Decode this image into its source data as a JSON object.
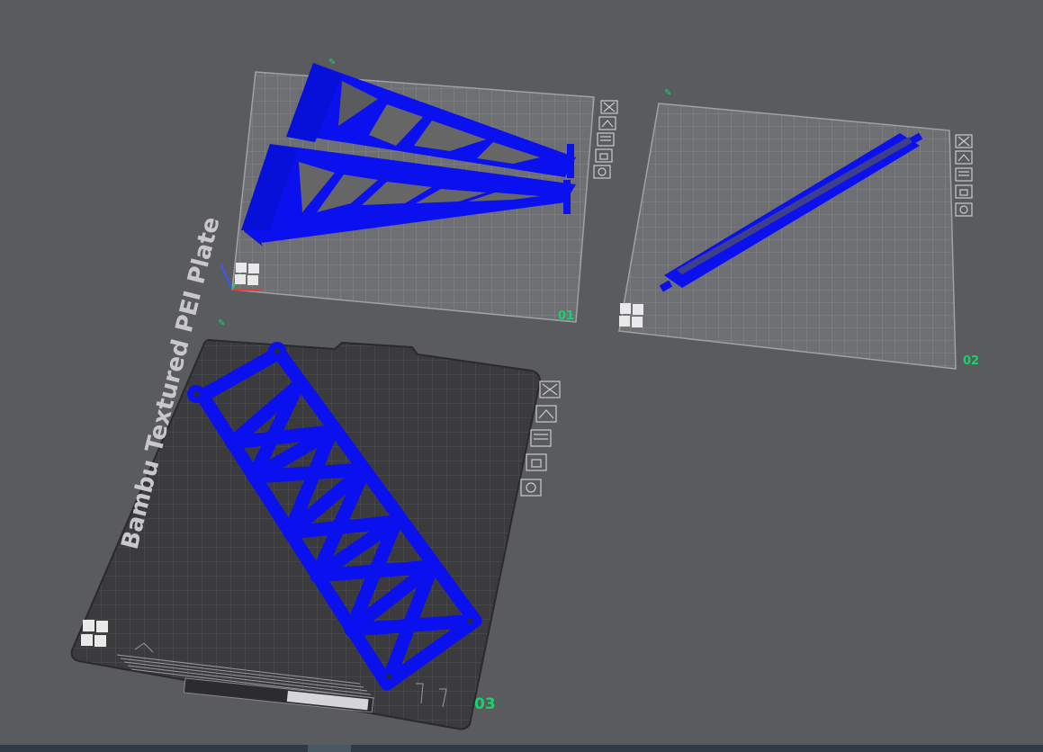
{
  "colors": {
    "background": "#5a5b5f",
    "plate_light": "#6b6c70",
    "plate_grid": "#8b8c90",
    "plate_dark": "#3a3a3d",
    "part": "#0a10ee",
    "plate_number": "#1bd26a"
  },
  "plates": [
    {
      "number": "01",
      "tool_icons": [
        "close-icon",
        "auto-orient-icon",
        "arrange-icon",
        "lock-icon",
        "settings-icon"
      ]
    },
    {
      "number": "02",
      "tool_icons": [
        "close-icon",
        "auto-orient-icon",
        "arrange-icon",
        "lock-icon",
        "settings-icon"
      ]
    },
    {
      "number": "03",
      "plate_label": "Bambu Textured PEI Plate",
      "tool_icons": [
        "close-icon",
        "auto-orient-icon",
        "arrange-icon",
        "lock-icon",
        "settings-icon"
      ]
    }
  ]
}
